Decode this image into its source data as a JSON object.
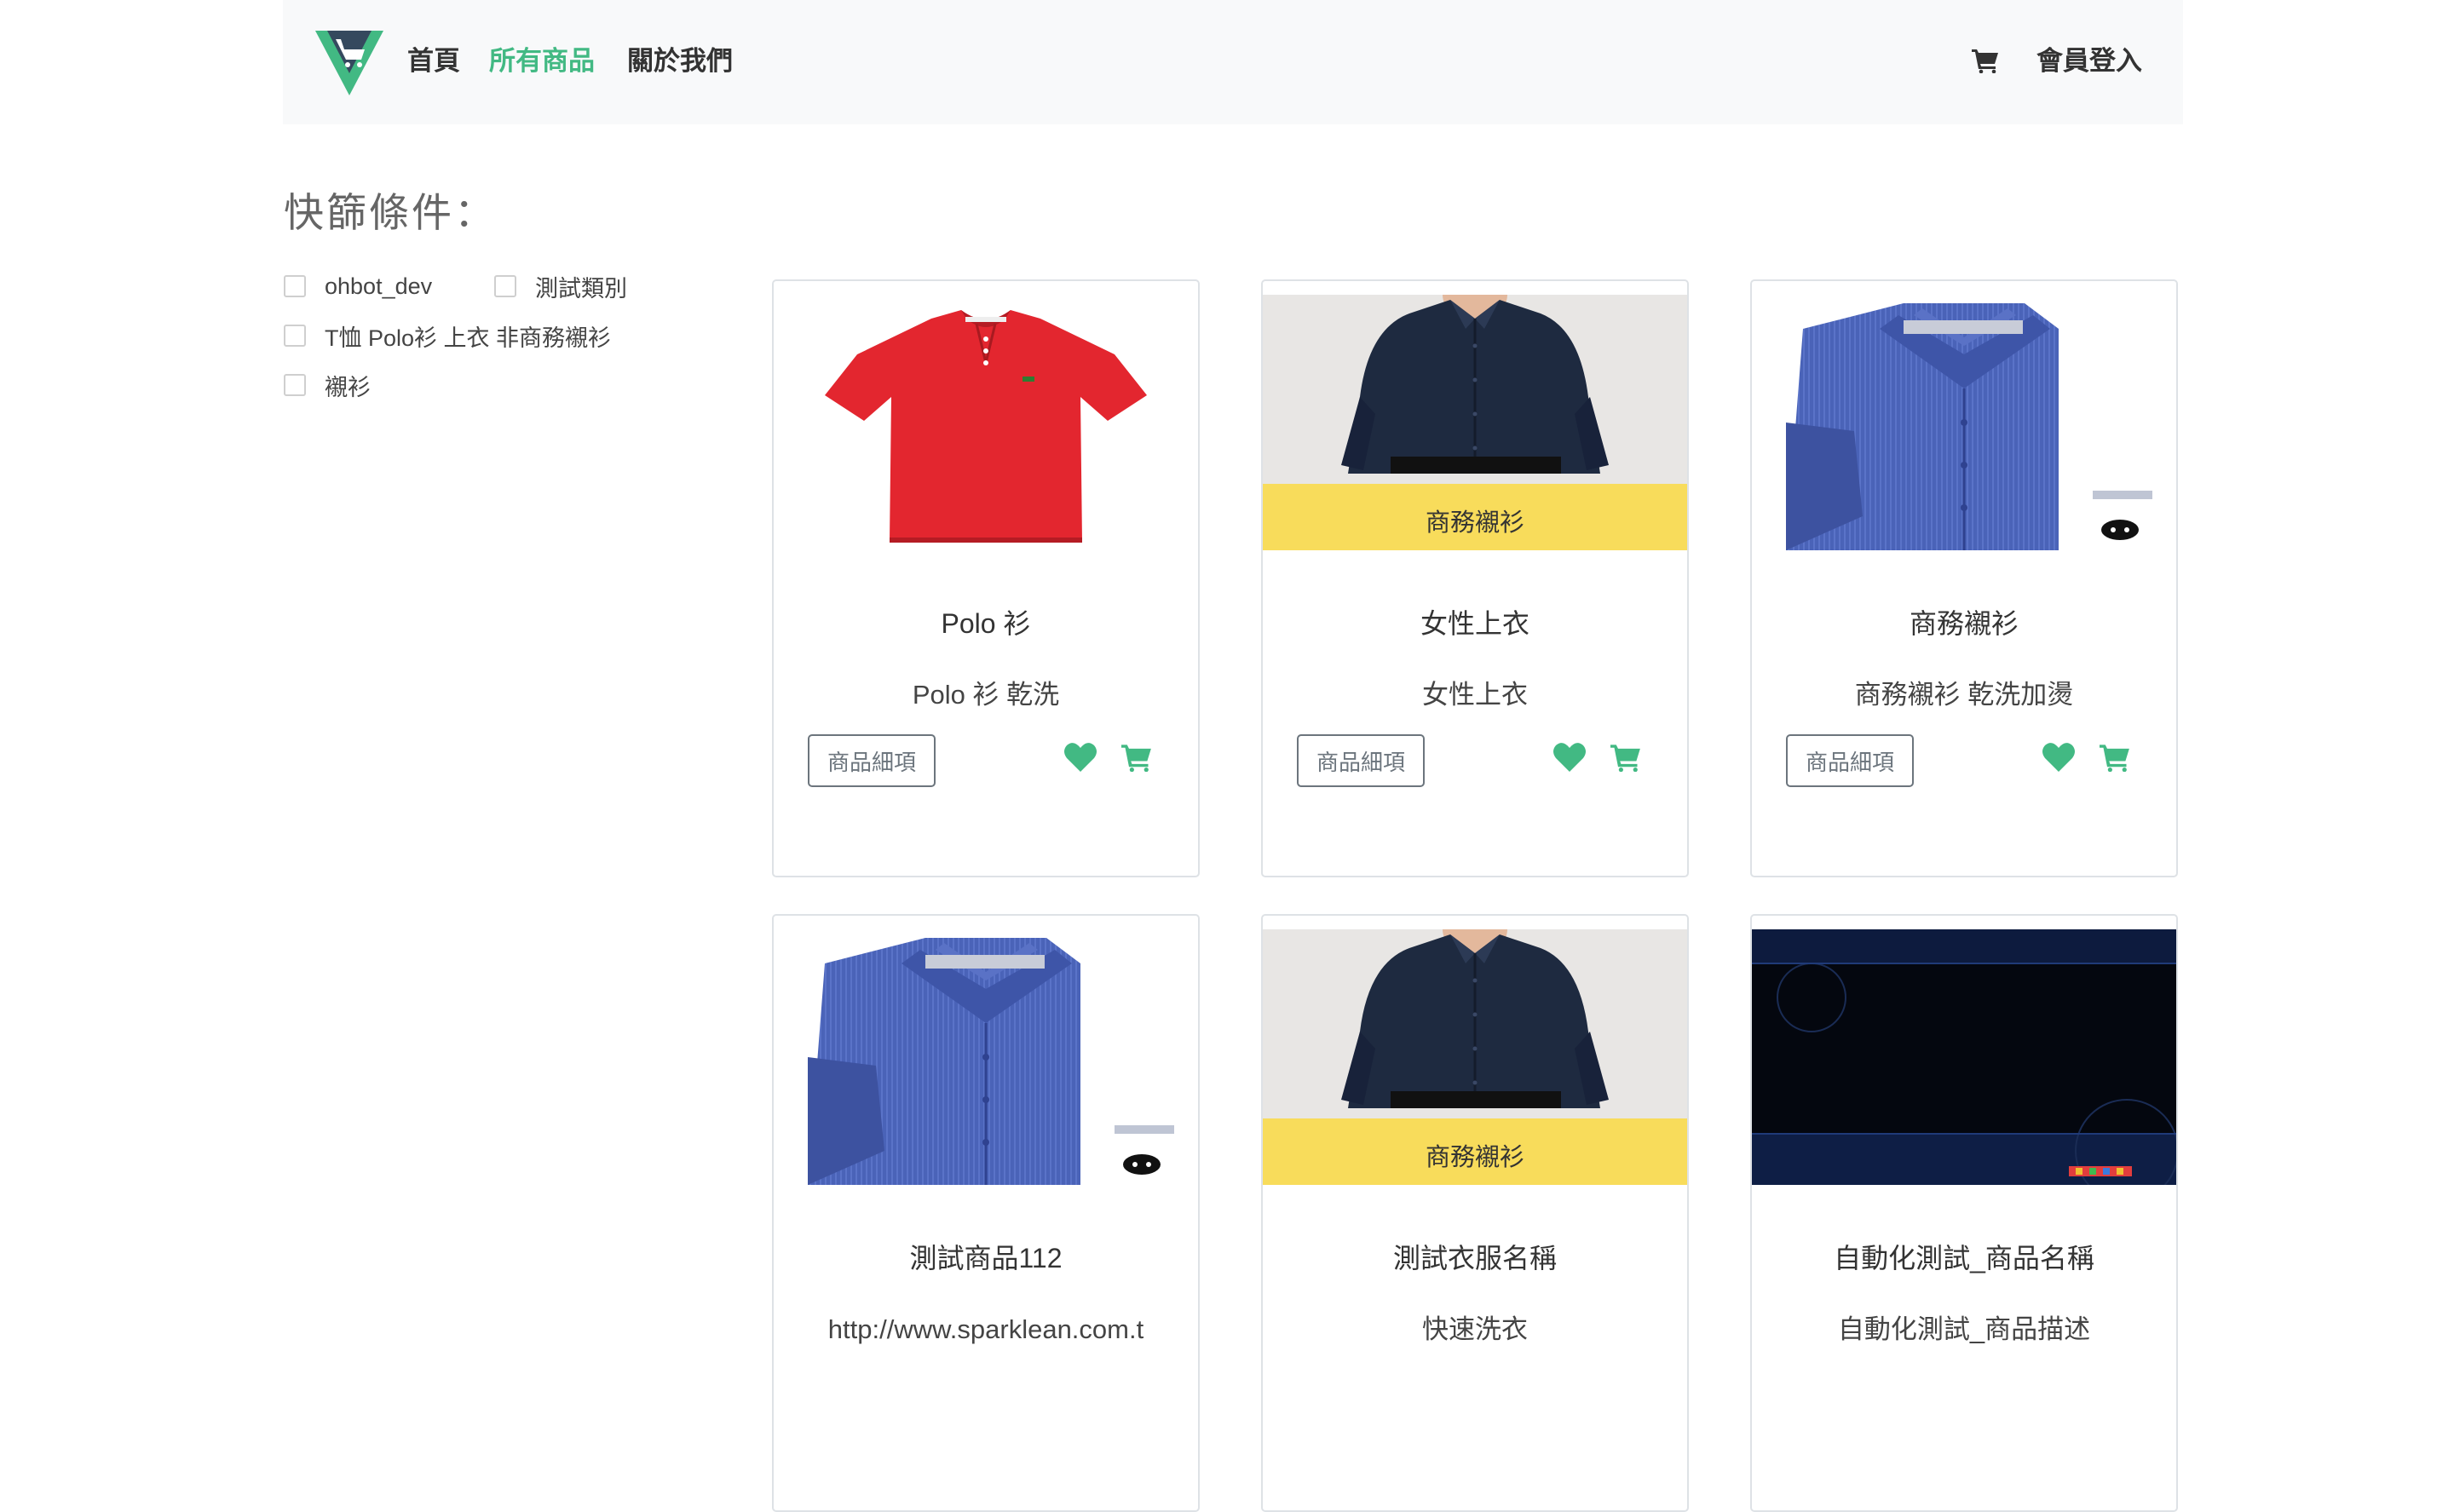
{
  "nav": {
    "links": [
      "首頁",
      "所有商品",
      "關於我們"
    ],
    "login": "會員登入",
    "accent_color": "#42b983"
  },
  "filter": {
    "title": "快篩條件：",
    "options": [
      "ohbot_dev",
      "測試類別",
      "T恤 Polo衫 上衣 非商務襯衫",
      "襯衫"
    ]
  },
  "products": [
    {
      "title": "Polo 衫",
      "description": "Polo 衫 乾洗",
      "badge": "",
      "image": "red-polo-shirt",
      "detail_label": "商品細項"
    },
    {
      "title": "女性上衣",
      "description": "女性上衣",
      "badge": "商務襯衫",
      "image": "navy-dress-shirt",
      "detail_label": "商品細項"
    },
    {
      "title": "商務襯衫",
      "description": "商務襯衫 乾洗加燙",
      "badge": "",
      "image": "blue-striped-shirt",
      "detail_label": "商品細項"
    },
    {
      "title": "測試商品112",
      "description": "http://www.sparklean.com.t",
      "badge": "",
      "image": "blue-striped-shirt",
      "detail_label": "商品細項"
    },
    {
      "title": "測試衣服名稱",
      "description": "快速洗衣",
      "badge": "商務襯衫",
      "image": "navy-dress-shirt",
      "detail_label": "商品細項"
    },
    {
      "title": "自動化測試_商品名稱",
      "description": "自動化測試_商品描述",
      "badge": "",
      "image": "dark-blue-screen",
      "detail_label": "商品細項"
    }
  ]
}
